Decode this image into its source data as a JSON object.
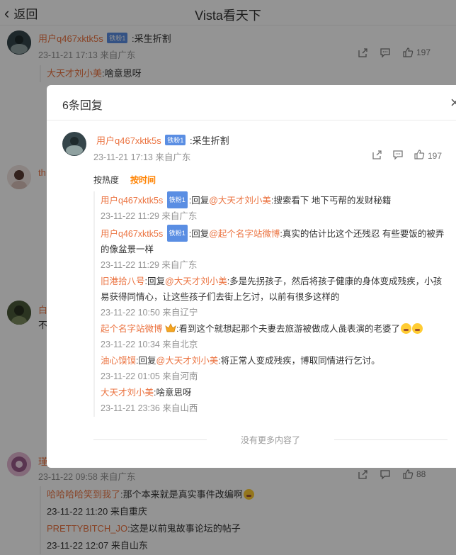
{
  "topbar": {
    "back_label": "返回",
    "title": "Vista看天下"
  },
  "background": {
    "top_comment": {
      "user": "用户q467xktk5s",
      "badge": "铁粉1",
      "text": ":采生折割",
      "time_loc": "23-11-21 17:13 来自广东",
      "likes": "197",
      "first_sub": {
        "name": "大天才刘小美",
        "text": ":啥意思呀"
      }
    },
    "side_names": [
      "th",
      "白",
      "瑾"
    ],
    "side_texts": [
      "不"
    ],
    "lower_comment": {
      "time_loc": "23-11-22 09:58 来自广东",
      "likes": "88",
      "subs": [
        {
          "name": "哈哈哈哈笑到我了",
          "text": ":那个本来就是真实事件改编啊",
          "meta": "23-11-22 11:20 来自重庆"
        },
        {
          "name": "PRETTYBITCH_JO",
          "text": ":这是以前鬼故事论坛的帖子",
          "meta": "23-11-22 12:07 来自山东"
        }
      ]
    }
  },
  "modal": {
    "title": "6条回复",
    "close_symbol": "×",
    "main": {
      "user": "用户q467xktk5s",
      "badge": "铁粉1",
      "text": ":采生折割",
      "time_loc": "23-11-21 17:13 来自广东",
      "likes": "197"
    },
    "sort": {
      "hot": "按热度",
      "time": "按时间"
    },
    "replies": [
      {
        "name": "用户q467xktk5s",
        "badge": "铁粉1",
        "pre": ":回复",
        "at": "@大天才刘小美",
        "text": ":搜索看下 地下丐帮的发财秘籍",
        "meta": "23-11-22 11:29 来自广东"
      },
      {
        "name": "用户q467xktk5s",
        "badge": "铁粉1",
        "pre": ":回复",
        "at": "@起个名字站微博",
        "text": ":真实的估计比这个还残忍 有些要饭的被弄的像盆景一样",
        "meta": "23-11-22 11:29 来自广东"
      },
      {
        "name": "旧港拾八号",
        "badge": "",
        "pre": ":回复",
        "at": "@大天才刘小美",
        "text": ":多是先拐孩子，然后将孩子健康的身体变成残疾，小孩易获得同情心，让这些孩子们去街上乞讨，以前有很多这样的",
        "meta": "23-11-22 10:50 来自辽宁"
      },
      {
        "name": "起个名字站微博",
        "badge": "",
        "pre": "",
        "at": "",
        "text": ":看到这个就想起那个夫妻去旅游被做成人彘表演的老婆了",
        "meta": "23-11-22 10:34 来自北京"
      },
      {
        "name": "油心馍馍",
        "badge": "",
        "pre": ":回复",
        "at": "@大天才刘小美",
        "text": ":将正常人变成残疾，博取同情进行乞讨。",
        "meta": "23-11-22 01:05 来自河南"
      },
      {
        "name": "大天才刘小美",
        "badge": "",
        "pre": "",
        "at": "",
        "text": ":啥意思呀",
        "meta": "23-11-21 23:36 来自山西"
      }
    ],
    "no_more": "没有更多内容了"
  },
  "colors": {
    "username": "#eb7340",
    "accent": "#ff8200",
    "badge": "#5a8ee3"
  }
}
